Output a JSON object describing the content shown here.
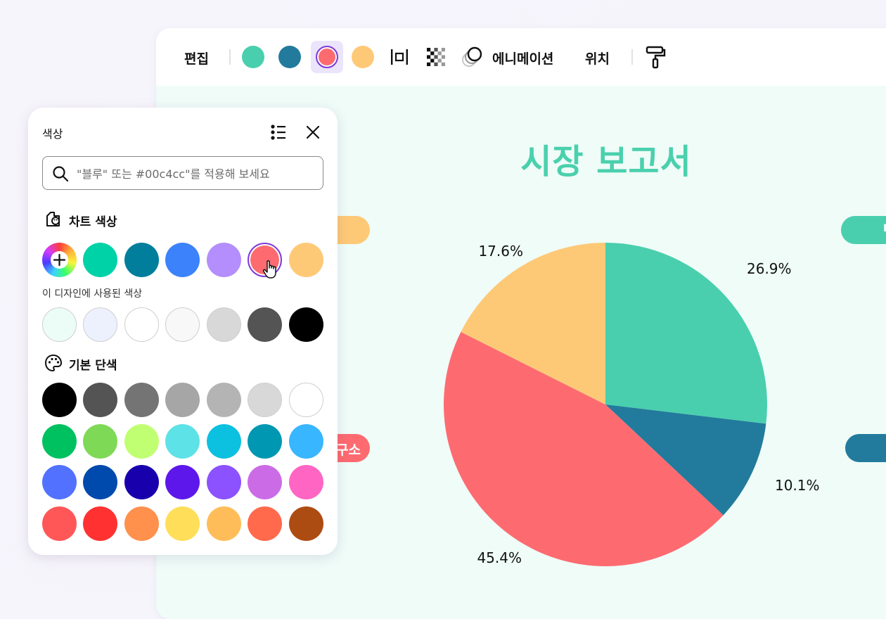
{
  "toolbar": {
    "edit_label": "편집",
    "animation_label": "에니메이션",
    "position_label": "위치",
    "colors": [
      "#4acfae",
      "#227b9c",
      "#fd6b71",
      "#fec977"
    ],
    "selected_index": 2
  },
  "slide": {
    "title": "시장 보고서",
    "left_pill_bottom_text": "구소",
    "right_pill_top_text": "L"
  },
  "chart_data": {
    "type": "pie",
    "slices": [
      {
        "label": "26.9%",
        "value": 26.9,
        "color": "#4acfae"
      },
      {
        "label": "10.1%",
        "value": 10.1,
        "color": "#227b9c"
      },
      {
        "label": "45.4%",
        "value": 45.4,
        "color": "#fd6b71"
      },
      {
        "label": "17.6%",
        "value": 17.6,
        "color": "#fec977"
      }
    ],
    "title": "시장 보고서"
  },
  "panel": {
    "title": "색상",
    "search_placeholder": "\"블루\" 또는 #00c4cc\"를 적용해 보세요",
    "chart_colors_label": "차트 색상",
    "chart_colors": [
      "#00d2a8",
      "#007e9c",
      "#3b82fb",
      "#b38efc",
      "#fd6b71",
      "#fec977"
    ],
    "selected_chart_color_index": 4,
    "used_colors_label": "이 디자인에 사용된 색상",
    "used_colors": [
      "#ecfdf8",
      "#edf1fe",
      "#ffffff",
      "#f8f8f8",
      "#d8d8d8",
      "#545454",
      "#000000"
    ],
    "solid_colors_label": "기본 단색",
    "solid_colors": [
      [
        "#000000",
        "#545454",
        "#747474",
        "#a6a6a6",
        "#b4b4b4",
        "#d8d8d8",
        "#ffffff"
      ],
      [
        "#00c160",
        "#7ed957",
        "#c1ff72",
        "#5de2e7",
        "#0cc0df",
        "#0097b2",
        "#38b6ff"
      ],
      [
        "#5271ff",
        "#004aad",
        "#1800ad",
        "#5e17eb",
        "#8c52ff",
        "#cb6ce6",
        "#ff66c4"
      ],
      [
        "#ff5757",
        "#ff3131",
        "#ff914d",
        "#ffde59",
        "#ffbd59",
        "#ff6a4d",
        "#ad4c12"
      ]
    ]
  }
}
